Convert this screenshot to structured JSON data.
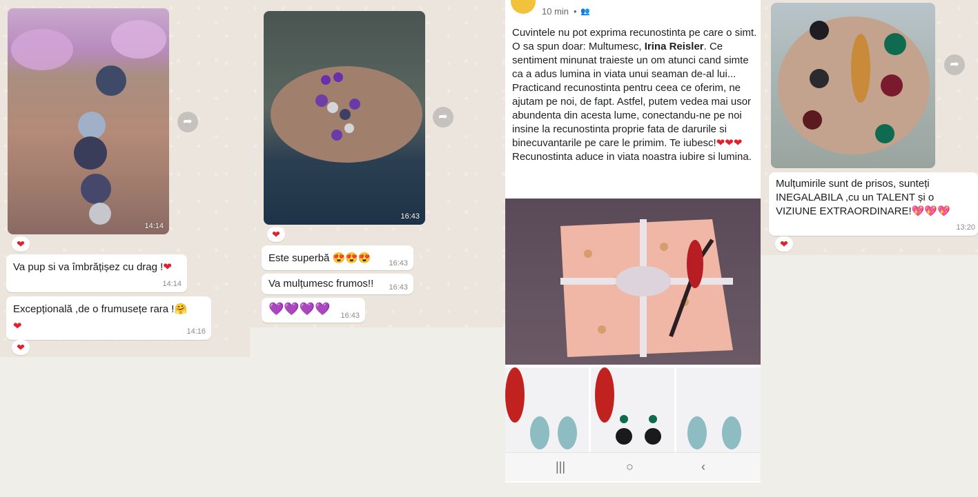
{
  "panel1": {
    "photo_time": "14:14",
    "messages": [
      {
        "text": "Va pup si va îmbrățișez cu drag !",
        "emoji": "❤",
        "time": "14:14"
      },
      {
        "text": "Excepțională ,de o frumusețe rara !",
        "emoji": "🤗",
        "emoji2": "❤",
        "time": "14:16"
      }
    ],
    "reaction": "❤"
  },
  "panel2": {
    "photo_time": "16:43",
    "messages": [
      {
        "text": "Este superbă",
        "emoji": "😍😍😍",
        "time": "16:43"
      },
      {
        "text": "Va mulțumesc frumos!!",
        "time": "16:43"
      },
      {
        "text": "",
        "emoji": "💜💜💜💜",
        "time": "16:43"
      }
    ],
    "reaction": "❤"
  },
  "panel3": {
    "post_time": "10 min",
    "post_separator": "•",
    "audience_icon": "friends-icon",
    "text_before": "Cuvintele nu pot exprima recunostinta pe care o simt. O sa spun doar: Multumesc, ",
    "name_bold": "Irina Reisler",
    "text_after": ". Ce sentiment minunat traieste un om atunci cand simte ca a adus lumina in viata unui seaman de-al lui... Practicand recunostinta pentru ceea ce oferim, ne ajutam pe noi, de fapt. Astfel, putem vedea mai usor abundenta din acesta lume, conectandu-ne pe noi insine la recunostinta proprie fata de darurile si binecuvantarile pe care le primim. Te iubesc!",
    "text_emoji": "❤❤❤",
    "text_line2": "Recunostinta aduce in viata noastra iubire si lumina.",
    "nav": {
      "recent": "|||",
      "home": "○",
      "back": "‹"
    }
  },
  "panel4": {
    "message": "Mulțumirile sunt de prisos, sunteți INEGALABILA ,cu un TALENT și o VIZIUNE EXTRAORDINARE!",
    "emoji": "💖💖💖",
    "time": "13:20",
    "reaction": "❤"
  },
  "icons": {
    "forward": "➦"
  }
}
